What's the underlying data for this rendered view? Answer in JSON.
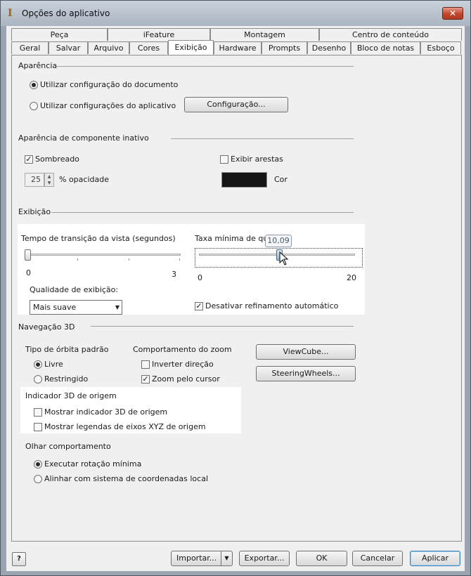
{
  "window": {
    "title": "Opções do aplicativo",
    "close_glyph": "✕",
    "app_glyph": "I"
  },
  "tabs_top": [
    "Peça",
    "iFeature",
    "Montagem",
    "Centro de conteúdo"
  ],
  "tabs_bottom": [
    "Geral",
    "Salvar",
    "Arquivo",
    "Cores",
    "Exibição",
    "Hardware",
    "Prompts",
    "Desenho",
    "Bloco de notas",
    "Esboço"
  ],
  "active_tab": "Exibição",
  "appearance": {
    "title": "Aparência",
    "option_document": "Utilizar configuração do documento",
    "option_app": "Utilizar configurações do aplicativo",
    "settings_button": "Configuração..."
  },
  "inactive": {
    "title": "Aparência de componente inativo",
    "shaded_label": "Sombreado",
    "show_edges_label": "Exibir arestas",
    "opacity_value": "25",
    "opacity_label": "% opacidade",
    "color_label": "Cor",
    "color_value": "#141414"
  },
  "display": {
    "title": "Exibição",
    "transition_label": "Tempo de transição da vista (segundos)",
    "transition_min": "0",
    "transition_max": "3",
    "transition_value": 0,
    "rate_label": "Taxa mínima de quad",
    "rate_min": "0",
    "rate_max": "20",
    "rate_tooltip": "10,09",
    "rate_value": 10.09,
    "quality_label": "Qualidade de exibição:",
    "quality_value": "Mais suave",
    "disable_refinement_label": "Desativar refinamento automático"
  },
  "nav3d": {
    "title": "Navegação 3D",
    "orbit_title": "Tipo de órbita padrão",
    "orbit_free": "Livre",
    "orbit_constrained": "Restringido",
    "zoom_title": "Comportamento do zoom",
    "zoom_invert": "Inverter direção",
    "zoom_cursor": "Zoom pelo cursor",
    "viewcube_button": "ViewCube...",
    "steering_button": "SteeringWheels...",
    "origin_title": "Indicador 3D de origem",
    "show_origin": "Mostrar indicador 3D de origem",
    "show_xyz": "Mostrar legendas de eixos XYZ de origem",
    "look_title": "Olhar comportamento",
    "look_min_rotation": "Executar rotação mínima",
    "look_align": "Alinhar com sistema de coordenadas local"
  },
  "footer": {
    "help_glyph": "?",
    "import_button": "Importar...",
    "export_button": "Exportar...",
    "ok_button": "OK",
    "cancel_button": "Cancelar",
    "apply_button": "Aplicar"
  }
}
